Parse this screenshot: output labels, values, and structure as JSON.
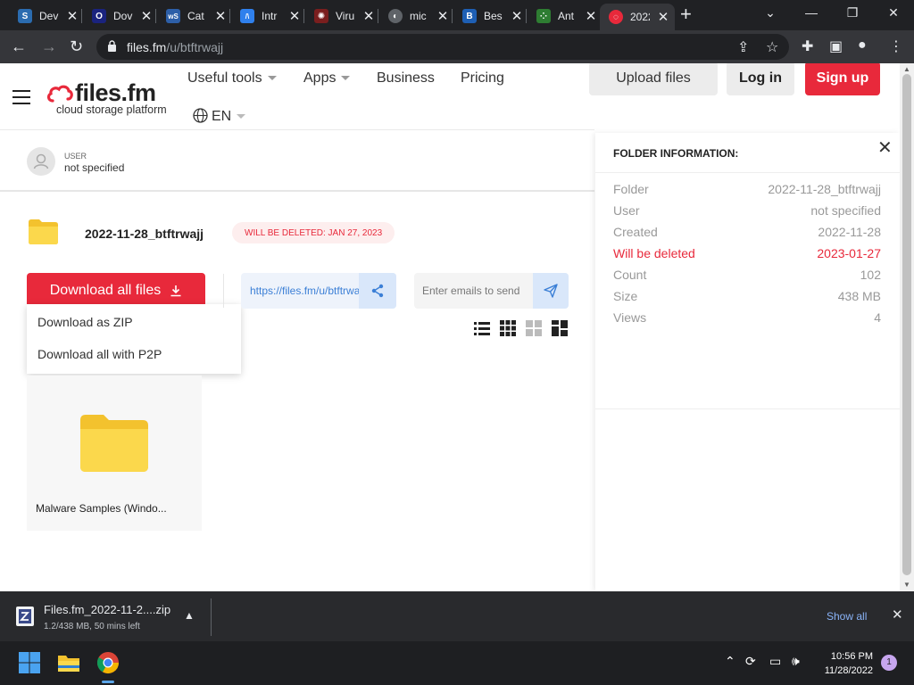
{
  "browser": {
    "tabs": [
      {
        "title": "Dev",
        "favicon_color": "#2b6cb0",
        "favicon": "S"
      },
      {
        "title": "Dov",
        "favicon_color": "#1a237e",
        "favicon": "O"
      },
      {
        "title": "Cat",
        "favicon_color": "#2d5fa8",
        "favicon": "wS"
      },
      {
        "title": "Intr",
        "favicon_color": "#2f80ed",
        "favicon": "/\\"
      },
      {
        "title": "Viru",
        "favicon_color": "#7a1e1e",
        "favicon": "✺"
      },
      {
        "title": "mic",
        "favicon_color": "#5f6368",
        "favicon": "◐"
      },
      {
        "title": "Bes",
        "favicon_color": "#1e5fb4",
        "favicon": "B"
      },
      {
        "title": "Ant",
        "favicon_color": "#2e7d32",
        "favicon": "⁘"
      },
      {
        "title": "2022",
        "favicon_color": "#e8293b",
        "favicon": "◌"
      }
    ],
    "address": {
      "domain": "files.fm",
      "path": "/u/btftrwajj"
    }
  },
  "site": {
    "logo_main": "files.fm",
    "logo_sub": "cloud storage platform",
    "nav": {
      "useful_tools": "Useful tools",
      "apps": "Apps",
      "business": "Business",
      "pricing": "Pricing",
      "language": "EN"
    },
    "buttons": {
      "upload": "Upload files",
      "login": "Log in",
      "signup": "Sign up"
    }
  },
  "user": {
    "label": "USER",
    "value": "not specified"
  },
  "folder": {
    "name": "2022-11-28_btftrwajj",
    "deletion_badge": "WILL BE DELETED: JAN 27, 2023",
    "download_label": "Download all files",
    "dropdown": [
      "Download as ZIP",
      "Download all with P2P"
    ],
    "share_url": "https://files.fm/u/btftrwajj",
    "email_placeholder": "Enter emails to send"
  },
  "files": [
    {
      "name": "Malware Samples (Windo..."
    }
  ],
  "info": {
    "title": "FOLDER INFORMATION:",
    "rows": [
      {
        "key": "Folder",
        "value": "2022-11-28_btftrwajj"
      },
      {
        "key": "User",
        "value": "not specified"
      },
      {
        "key": "Created",
        "value": "2022-11-28"
      },
      {
        "key": "Will be deleted",
        "value": "2023-01-27"
      },
      {
        "key": "Count",
        "value": "102"
      },
      {
        "key": "Size",
        "value": "438 MB"
      },
      {
        "key": "Views",
        "value": "4"
      }
    ]
  },
  "download_bar": {
    "filename": "Files.fm_2022-11-2....zip",
    "status": "1.2/438 MB, 50 mins left",
    "show_all": "Show all"
  },
  "taskbar": {
    "time": "10:56 PM",
    "date": "11/28/2022",
    "notifications": "1"
  },
  "colors": {
    "brand_red": "#e8293b",
    "link_blue": "#3b7fd6",
    "chrome_dark": "#202124"
  }
}
